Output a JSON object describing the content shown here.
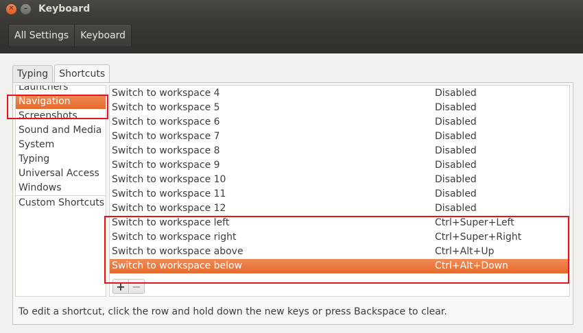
{
  "window": {
    "title": "Keyboard"
  },
  "breadcrumb": {
    "items": [
      "All Settings",
      "Keyboard"
    ]
  },
  "tabs": [
    {
      "label": "Typing",
      "active": false
    },
    {
      "label": "Shortcuts",
      "active": true
    }
  ],
  "categories": [
    {
      "label": "Launchers",
      "selected": false
    },
    {
      "label": "Navigation",
      "selected": true
    },
    {
      "label": "Screenshots",
      "selected": false
    },
    {
      "label": "Sound and Media",
      "selected": false
    },
    {
      "label": "System",
      "selected": false
    },
    {
      "label": "Typing",
      "selected": false
    },
    {
      "label": "Universal Access",
      "selected": false
    },
    {
      "label": "Windows",
      "selected": false
    },
    {
      "label": "Custom Shortcuts",
      "selected": false
    }
  ],
  "shortcuts": [
    {
      "name": "Switch to workspace 4",
      "accel": "Disabled"
    },
    {
      "name": "Switch to workspace 5",
      "accel": "Disabled"
    },
    {
      "name": "Switch to workspace 6",
      "accel": "Disabled"
    },
    {
      "name": "Switch to workspace 7",
      "accel": "Disabled"
    },
    {
      "name": "Switch to workspace 8",
      "accel": "Disabled"
    },
    {
      "name": "Switch to workspace 9",
      "accel": "Disabled"
    },
    {
      "name": "Switch to workspace 10",
      "accel": "Disabled"
    },
    {
      "name": "Switch to workspace 11",
      "accel": "Disabled"
    },
    {
      "name": "Switch to workspace 12",
      "accel": "Disabled"
    },
    {
      "name": "Switch to workspace left",
      "accel": "Ctrl+Super+Left"
    },
    {
      "name": "Switch to workspace right",
      "accel": "Ctrl+Super+Right"
    },
    {
      "name": "Switch to workspace above",
      "accel": "Ctrl+Alt+Up"
    },
    {
      "name": "Switch to workspace below",
      "accel": "Ctrl+Alt+Down",
      "selected": true
    }
  ],
  "buttons": {
    "add": "+",
    "remove": "−"
  },
  "hint": "To edit a shortcut, click the row and hold down the new keys or press Backspace to clear.",
  "colors": {
    "selection": "#e9702f",
    "annotation": "#e2141e",
    "titlebar": "#3c3b37"
  },
  "icons": {
    "close": "close-icon",
    "minimize": "minimize-icon"
  }
}
